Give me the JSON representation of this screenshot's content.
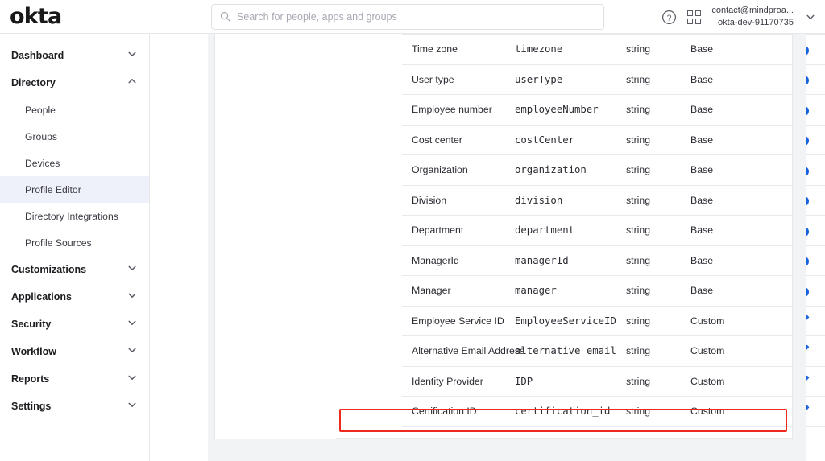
{
  "brand": {
    "logo_text": "okta",
    "accent_blue": "#1662dd",
    "highlight_red": "#ee2a1e",
    "active_nav_bg": "#eef0fa"
  },
  "header": {
    "search": {
      "placeholder": "Search for people, apps and groups",
      "value": ""
    },
    "help_icon": "question-circle-icon",
    "apps_icon": "apps-grid-icon",
    "account": {
      "email": "contact@mindproa...",
      "org": "okta-dev-91170735",
      "chevron": "chevron-down-icon"
    }
  },
  "sidebar": {
    "items": [
      {
        "label": "Dashboard",
        "type": "group",
        "expanded": false,
        "chevron": "chevron-down-icon"
      },
      {
        "label": "Directory",
        "type": "group",
        "expanded": true,
        "chevron": "chevron-up-icon"
      },
      {
        "label": "People",
        "type": "child",
        "active": false
      },
      {
        "label": "Groups",
        "type": "child",
        "active": false
      },
      {
        "label": "Devices",
        "type": "child",
        "active": false
      },
      {
        "label": "Profile Editor",
        "type": "child",
        "active": true
      },
      {
        "label": "Directory Integrations",
        "type": "child",
        "active": false
      },
      {
        "label": "Profile Sources",
        "type": "child",
        "active": false
      },
      {
        "label": "Customizations",
        "type": "group",
        "expanded": false,
        "chevron": "chevron-down-icon"
      },
      {
        "label": "Applications",
        "type": "group",
        "expanded": false,
        "chevron": "chevron-down-icon"
      },
      {
        "label": "Security",
        "type": "group",
        "expanded": false,
        "chevron": "chevron-down-icon"
      },
      {
        "label": "Workflow",
        "type": "group",
        "expanded": false,
        "chevron": "chevron-down-icon"
      },
      {
        "label": "Reports",
        "type": "group",
        "expanded": false,
        "chevron": "chevron-down-icon"
      },
      {
        "label": "Settings",
        "type": "group",
        "expanded": false,
        "chevron": "chevron-down-icon"
      }
    ]
  },
  "attributes_table": {
    "rows": [
      {
        "display_name": "Time zone",
        "variable_name": "timezone",
        "data_type": "string",
        "attribute_type": "Base",
        "action1": "info-icon",
        "action2": "remove-icon",
        "action2_state": "disabled",
        "highlighted": false
      },
      {
        "display_name": "User type",
        "variable_name": "userType",
        "data_type": "string",
        "attribute_type": "Base",
        "action1": "info-icon",
        "action2": "remove-icon",
        "action2_state": "disabled",
        "highlighted": false
      },
      {
        "display_name": "Employee number",
        "variable_name": "employeeNumber",
        "data_type": "string",
        "attribute_type": "Base",
        "action1": "info-icon",
        "action2": "remove-icon",
        "action2_state": "disabled",
        "highlighted": false
      },
      {
        "display_name": "Cost center",
        "variable_name": "costCenter",
        "data_type": "string",
        "attribute_type": "Base",
        "action1": "info-icon",
        "action2": "remove-icon",
        "action2_state": "disabled",
        "highlighted": false
      },
      {
        "display_name": "Organization",
        "variable_name": "organization",
        "data_type": "string",
        "attribute_type": "Base",
        "action1": "info-icon",
        "action2": "remove-icon",
        "action2_state": "disabled",
        "highlighted": false
      },
      {
        "display_name": "Division",
        "variable_name": "division",
        "data_type": "string",
        "attribute_type": "Base",
        "action1": "info-icon",
        "action2": "remove-icon",
        "action2_state": "disabled",
        "highlighted": false
      },
      {
        "display_name": "Department",
        "variable_name": "department",
        "data_type": "string",
        "attribute_type": "Base",
        "action1": "info-icon",
        "action2": "remove-icon",
        "action2_state": "disabled",
        "highlighted": false
      },
      {
        "display_name": "ManagerId",
        "variable_name": "managerId",
        "data_type": "string",
        "attribute_type": "Base",
        "action1": "info-icon",
        "action2": "remove-icon",
        "action2_state": "disabled",
        "highlighted": false
      },
      {
        "display_name": "Manager",
        "variable_name": "manager",
        "data_type": "string",
        "attribute_type": "Base",
        "action1": "info-icon",
        "action2": "remove-icon",
        "action2_state": "disabled",
        "highlighted": false
      },
      {
        "display_name": "Employee Service ID",
        "variable_name": "EmployeeServiceID",
        "data_type": "string",
        "attribute_type": "Custom",
        "action1": "edit-pencil-icon",
        "action2": "remove-icon",
        "action2_state": "enabled",
        "highlighted": false
      },
      {
        "display_name": "Alternative Email Address",
        "variable_name": "alternative_email",
        "data_type": "string",
        "attribute_type": "Custom",
        "action1": "edit-pencil-icon",
        "action2": "remove-icon",
        "action2_state": "enabled",
        "highlighted": false
      },
      {
        "display_name": "Identity Provider",
        "variable_name": "IDP",
        "data_type": "string",
        "attribute_type": "Custom",
        "action1": "edit-pencil-icon",
        "action2": "remove-icon",
        "action2_state": "enabled",
        "highlighted": false
      },
      {
        "display_name": "Certification ID",
        "variable_name": "certification_id",
        "data_type": "string",
        "attribute_type": "Custom",
        "action1": "edit-pencil-icon",
        "action2": "remove-icon",
        "action2_state": "enabled",
        "highlighted": true
      }
    ]
  }
}
